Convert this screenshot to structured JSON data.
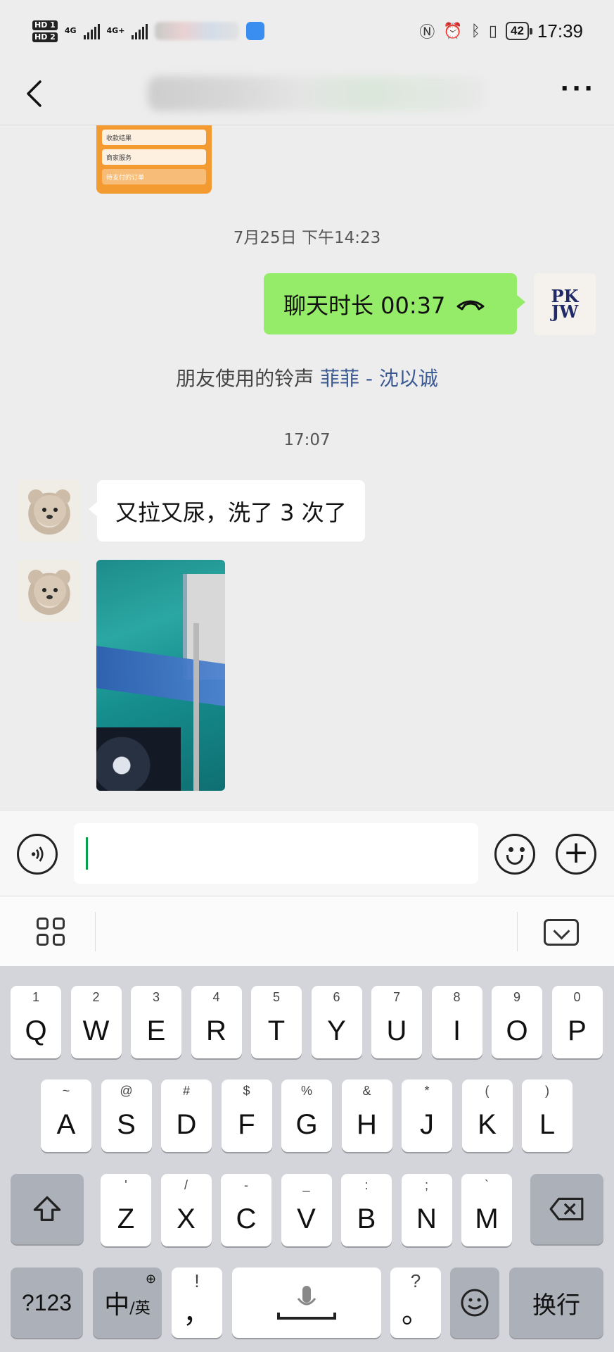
{
  "status_bar": {
    "hd1": "HD 1",
    "hd2": "HD 2",
    "net1": "4G",
    "net2": "4G+",
    "battery": "42",
    "time": "17:39"
  },
  "header": {
    "back_icon": "chevron-left-icon",
    "more_icon": "more-dots-icon",
    "more_label": "···"
  },
  "messages": {
    "card_rows": [
      "收款结果",
      "商家服务",
      "待支付的订单"
    ],
    "timestamp1": "7月25日 下午14:23",
    "call_text": "聊天时长 00:37",
    "my_avatar_text": "PK\nJW",
    "ringtone_prefix": "朋友使用的铃声 ",
    "ringtone_song": "菲菲 - 沈以诚",
    "timestamp2": "17:07",
    "received_text": "又拉又尿，洗了 3 次了"
  },
  "input_bar": {
    "voice_icon": "voice-icon",
    "emoji_icon": "emoji-icon",
    "plus_icon": "plus-icon",
    "plus_label": "+"
  },
  "keyboard": {
    "row1": [
      {
        "sub": "1",
        "main": "Q"
      },
      {
        "sub": "2",
        "main": "W"
      },
      {
        "sub": "3",
        "main": "E"
      },
      {
        "sub": "4",
        "main": "R"
      },
      {
        "sub": "5",
        "main": "T"
      },
      {
        "sub": "6",
        "main": "Y"
      },
      {
        "sub": "7",
        "main": "U"
      },
      {
        "sub": "8",
        "main": "I"
      },
      {
        "sub": "9",
        "main": "O"
      },
      {
        "sub": "0",
        "main": "P"
      }
    ],
    "row2": [
      {
        "sub": "~",
        "main": "A"
      },
      {
        "sub": "@",
        "main": "S"
      },
      {
        "sub": "#",
        "main": "D"
      },
      {
        "sub": "$",
        "main": "F"
      },
      {
        "sub": "%",
        "main": "G"
      },
      {
        "sub": "&",
        "main": "H"
      },
      {
        "sub": "*",
        "main": "J"
      },
      {
        "sub": "(",
        "main": "K"
      },
      {
        "sub": ")",
        "main": "L"
      }
    ],
    "row3": [
      {
        "sub": "'",
        "main": "Z"
      },
      {
        "sub": "/",
        "main": "X"
      },
      {
        "sub": "-",
        "main": "C"
      },
      {
        "sub": "_",
        "main": "V"
      },
      {
        "sub": ":",
        "main": "B"
      },
      {
        "sub": ";",
        "main": "N"
      },
      {
        "sub": "`",
        "main": "M"
      }
    ],
    "symbols_key": "?123",
    "lang_main": "中",
    "lang_sub": "/英",
    "excl_sub": "!",
    "comma_main": "，",
    "question_sub": "?",
    "period_main": "。",
    "enter_key": "换行"
  }
}
